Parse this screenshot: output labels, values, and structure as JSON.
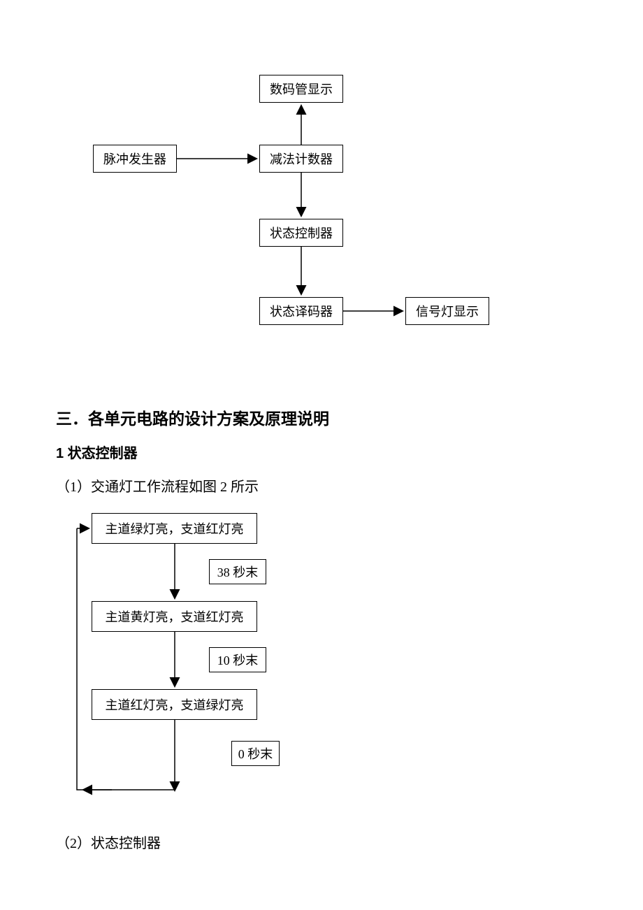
{
  "diagram1": {
    "pulse": "脉冲发生器",
    "counter": "减法计数器",
    "display": "数码管显示",
    "state_ctrl": "状态控制器",
    "decoder": "状态译码器",
    "signal_out": "信号灯显示"
  },
  "section": {
    "h2": "三．各单元电路的设计方案及原理说明",
    "h3": "1 状态控制器",
    "p1": "（1）交通灯工作流程如图 2 所示",
    "p2": "（2）状态控制器"
  },
  "diagram2": {
    "s1": "主道绿灯亮，支道红灯亮",
    "t1": "38 秒末",
    "s2": "主道黄灯亮，支道红灯亮",
    "t2": "10 秒末",
    "s3": "主道红灯亮，支道绿灯亮",
    "t3": "0 秒末"
  }
}
